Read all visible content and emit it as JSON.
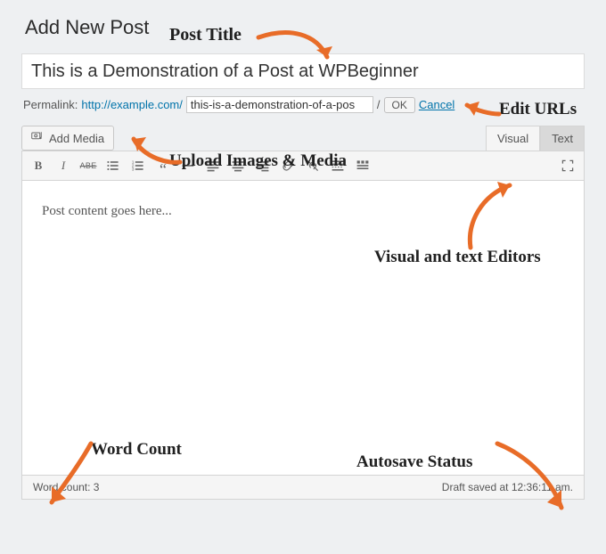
{
  "page": {
    "heading": "Add New Post",
    "title_value": "This is a Demonstration of a Post at WPBeginner",
    "permalink_label": "Permalink:",
    "permalink_base": "http://example.com/",
    "slug_value": "this-is-a-demonstration-of-a-pos",
    "ok_label": "OK",
    "cancel_label": "Cancel",
    "add_media_label": "Add Media",
    "tabs": {
      "visual": "Visual",
      "text": "Text"
    },
    "content_text": "Post content goes here...",
    "word_count_label": "Word count: 3",
    "autosave_label": "Draft saved at 12:36:11 am."
  },
  "annotations": {
    "post_title": "Post Title",
    "edit_urls": "Edit URLs",
    "upload_media": "Upload Images & Media",
    "visual_text": "Visual and text Editors",
    "word_count": "Word Count",
    "autosave": "Autosave Status"
  }
}
